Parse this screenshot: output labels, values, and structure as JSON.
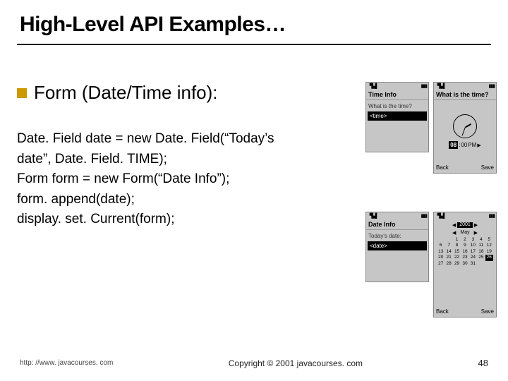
{
  "title": "High-Level API Examples…",
  "bullet": "Form (Date/Time info):",
  "code": {
    "l1": "Date. Field date = new Date. Field(“Today’s",
    "l2": "date”, Date. Field. TIME);",
    "l3": "Form form = new Form(“Date Info”);",
    "l4": "form. append(date);",
    "l5": "display. set. Current(form);"
  },
  "phone_timeinfo": {
    "title": "Time Info",
    "question": "What is the time?",
    "value": "<time>"
  },
  "phone_clock": {
    "title": "What is the time?",
    "hh": "08",
    "mm": "00",
    "ampm": "PM",
    "back": "Back",
    "save": "Save"
  },
  "phone_dateinfo": {
    "title": "Date Info",
    "label": "Today's date:",
    "value": "<date>"
  },
  "phone_cal": {
    "year": "2001",
    "month": "May",
    "back": "Back",
    "save": "Save",
    "selected": "26",
    "days": [
      "",
      "",
      "1",
      "2",
      "3",
      "4",
      "5",
      "6",
      "7",
      "8",
      "9",
      "10",
      "11",
      "12",
      "13",
      "14",
      "15",
      "16",
      "17",
      "18",
      "19",
      "20",
      "21",
      "22",
      "23",
      "24",
      "25",
      "26",
      "27",
      "28",
      "29",
      "30",
      "31",
      "",
      ""
    ]
  },
  "footer": {
    "left": "http: //www. javacourses. com",
    "center": "Copyright © 2001 javacourses. com",
    "right": "48"
  }
}
